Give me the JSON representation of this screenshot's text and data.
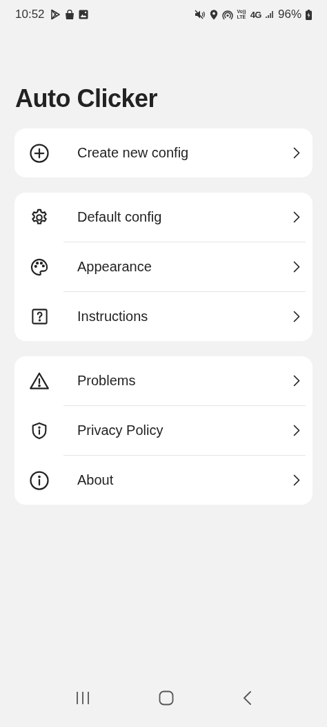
{
  "status_bar": {
    "time": "10:52",
    "volte": "Vo))",
    "lte": "LTE",
    "network": "4G",
    "battery": "96%"
  },
  "title": "Auto Clicker",
  "groups": [
    {
      "items": [
        {
          "label": "Create new config"
        }
      ]
    },
    {
      "items": [
        {
          "label": "Default config"
        },
        {
          "label": "Appearance"
        },
        {
          "label": "Instructions"
        }
      ]
    },
    {
      "items": [
        {
          "label": "Problems"
        },
        {
          "label": "Privacy Policy"
        },
        {
          "label": "About"
        }
      ]
    }
  ]
}
